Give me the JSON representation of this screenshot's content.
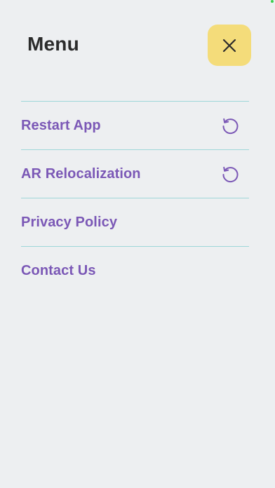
{
  "header": {
    "title": "Menu"
  },
  "colors": {
    "background": "#edeff1",
    "close_button": "#f4dc7a",
    "accent": "#7b58b6",
    "divider": "#9ed6d8",
    "title_text": "#2b2b2b"
  },
  "icons": {
    "close": "close-icon",
    "reload": "refresh-icon"
  },
  "menu": {
    "items": [
      {
        "label": "Restart App",
        "icon": "refresh-icon"
      },
      {
        "label": "AR Relocalization",
        "icon": "refresh-icon"
      },
      {
        "label": "Privacy Policy"
      },
      {
        "label": "Contact Us"
      }
    ]
  }
}
